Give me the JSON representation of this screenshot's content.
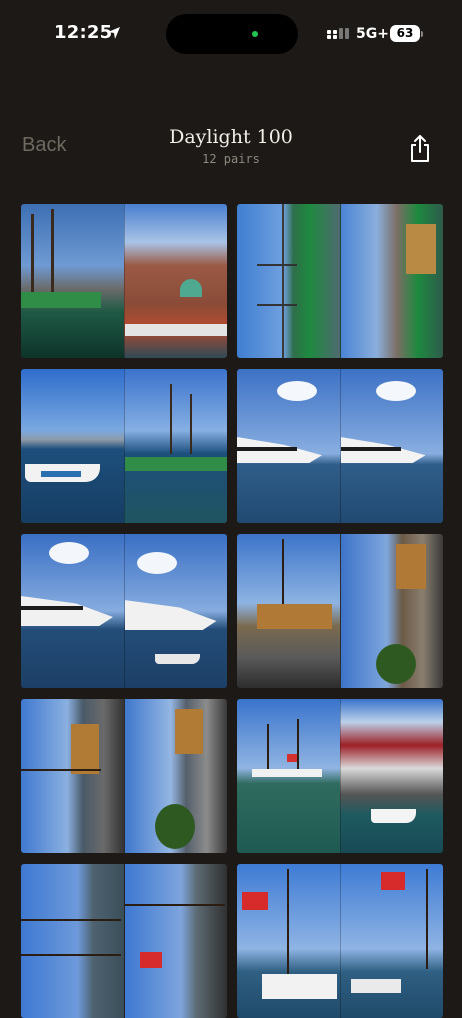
{
  "status_bar": {
    "time": "12:25",
    "network": "5G+",
    "battery": "63",
    "icons": [
      "location-arrow-icon",
      "signal-icon",
      "battery-icon"
    ]
  },
  "nav": {
    "back_label": "Back",
    "title": "Daylight 100",
    "subtitle": "12 pairs",
    "share_icon": "share-icon"
  },
  "colors": {
    "background": "#1c1916",
    "title": "#f2efe8",
    "back": "#6e6a60",
    "subtitle": "#8d887e"
  },
  "pairs": [
    {
      "left": "harbor-ships",
      "right": "rowes-wharf"
    },
    {
      "left": "rotated-ship-masts",
      "right": "rotated-city-pier"
    },
    {
      "left": "speedboat-bay",
      "right": "tall-ship-dock"
    },
    {
      "left": "cruise-yacht",
      "right": "cruise-yacht"
    },
    {
      "left": "cruise-yacht-clouds",
      "right": "cruise-yacht-boat"
    },
    {
      "left": "galleon-pier",
      "right": "rotated-crowd-pier"
    },
    {
      "left": "rotated-galleon",
      "right": "rotated-galleon-crowd"
    },
    {
      "left": "tall-ship-harbor",
      "right": "pavilion-boat"
    },
    {
      "left": "rotated-rigging",
      "right": "rotated-flag-rigging"
    },
    {
      "left": "canada-flag-ship",
      "right": "canada-flag-masts"
    }
  ]
}
